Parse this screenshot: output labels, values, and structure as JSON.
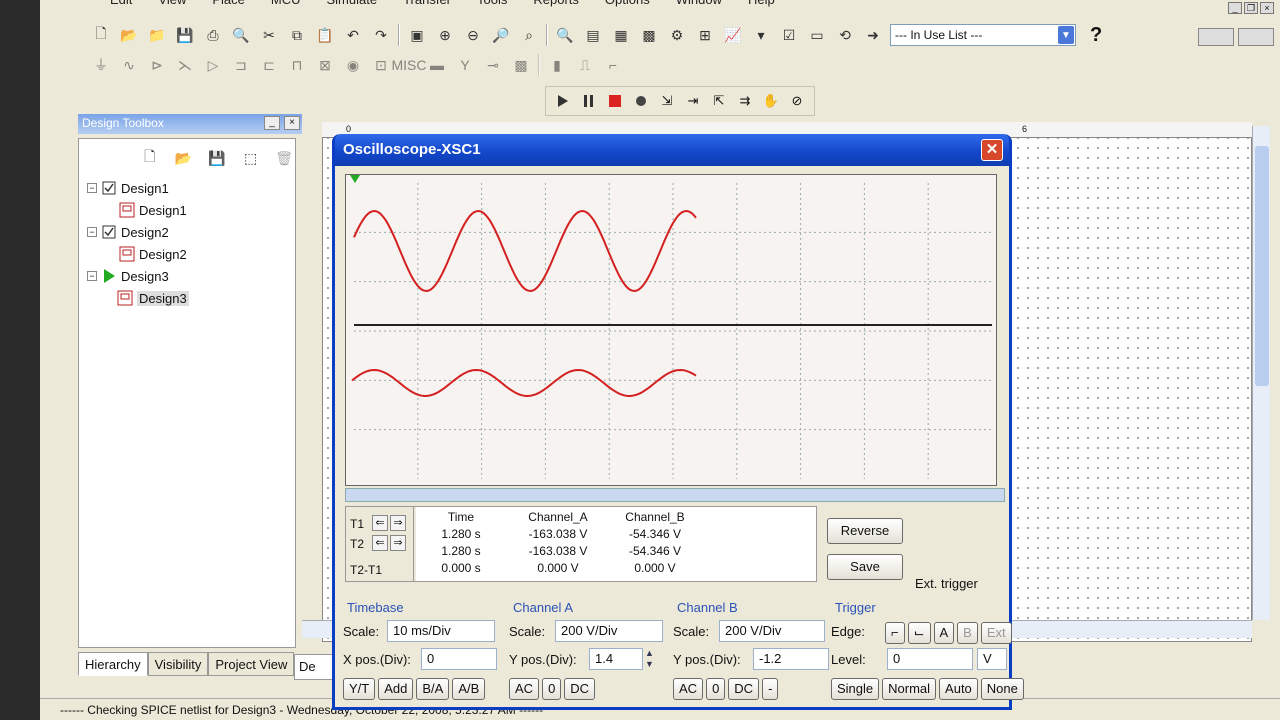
{
  "menu": [
    "Edit",
    "View",
    "Place",
    "MCU",
    "Simulate",
    "Transfer",
    "Tools",
    "Reports",
    "Options",
    "Window",
    "Help"
  ],
  "toolbar": {
    "in_use_list": "--- In Use List ---"
  },
  "toolbox": {
    "title": "Design Toolbox",
    "tree": [
      {
        "label": "Design1",
        "level": 0
      },
      {
        "label": "Design1",
        "level": 1
      },
      {
        "label": "Design2",
        "level": 0
      },
      {
        "label": "Design2",
        "level": 1
      },
      {
        "label": "Design3",
        "level": 0
      },
      {
        "label": "Design3",
        "level": 1
      }
    ],
    "tabs": [
      "Hierarchy",
      "Visibility",
      "Project View"
    ]
  },
  "ruler": {
    "left": "0",
    "right": "6"
  },
  "doc_tab": "De",
  "status_text": "------ Checking SPICE netlist for Design3 - Wednesday, October 22, 2008, 5:23:27 AM ------",
  "oscilloscope": {
    "title": "Oscilloscope-XSC1",
    "cursors": {
      "labels": [
        "T1",
        "T2",
        "T2-T1"
      ],
      "headers": [
        "Time",
        "Channel_A",
        "Channel_B"
      ],
      "rows": [
        [
          "1.280 s",
          "-163.038 V",
          "-54.346 V"
        ],
        [
          "1.280 s",
          "-163.038 V",
          "-54.346 V"
        ],
        [
          "0.000 s",
          "0.000 V",
          "0.000 V"
        ]
      ]
    },
    "buttons": {
      "reverse": "Reverse",
      "save": "Save",
      "ext_trigger": "Ext. trigger"
    },
    "timebase": {
      "title": "Timebase",
      "scale_label": "Scale:",
      "scale": "10 ms/Div",
      "xpos_label": "X pos.(Div):",
      "xpos": "0",
      "modes": [
        "Y/T",
        "Add",
        "B/A",
        "A/B"
      ]
    },
    "channel_a": {
      "title": "Channel A",
      "scale_label": "Scale:",
      "scale": "200  V/Div",
      "ypos_label": "Y pos.(Div):",
      "ypos": "1.4",
      "coupling": [
        "AC",
        "0",
        "DC"
      ]
    },
    "channel_b": {
      "title": "Channel B",
      "scale_label": "Scale:",
      "scale": "200  V/Div",
      "ypos_label": "Y pos.(Div):",
      "ypos": "-1.2",
      "coupling": [
        "AC",
        "0",
        "DC",
        "-"
      ]
    },
    "trigger": {
      "title": "Trigger",
      "edge_label": "Edge:",
      "sources": [
        "A",
        "B",
        "Ext"
      ],
      "level_label": "Level:",
      "level": "0",
      "level_unit": "V",
      "modes": [
        "Single",
        "Normal",
        "Auto",
        "None"
      ]
    }
  },
  "colors": {
    "trace": "#d42020",
    "title_bar": "#1246c8",
    "group_title": "#2a52b8"
  }
}
